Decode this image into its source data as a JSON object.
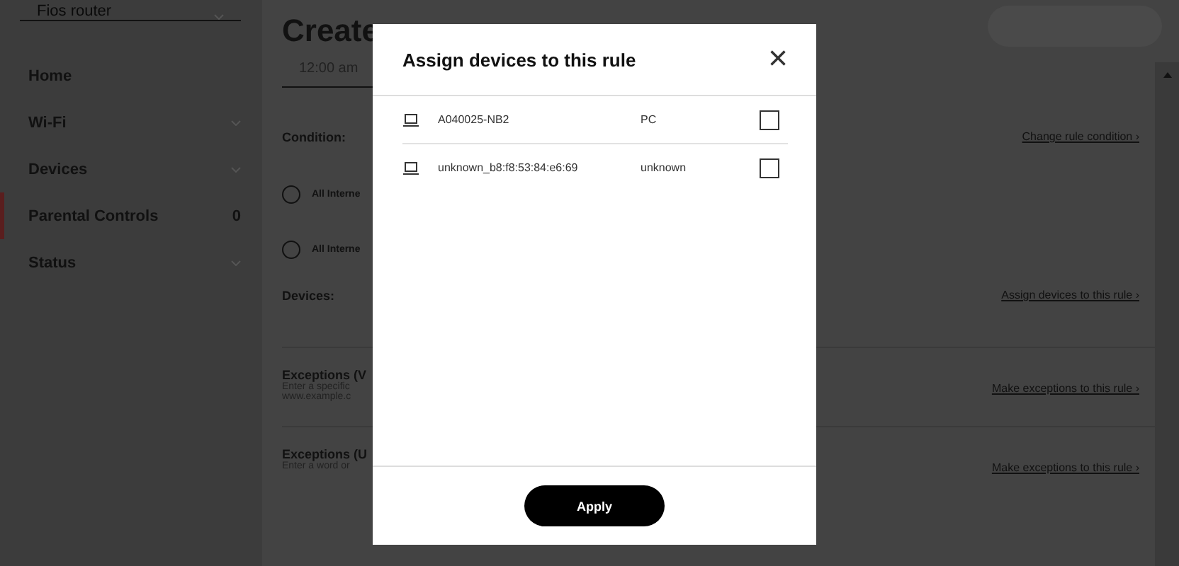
{
  "sidebar": {
    "router_select": "Fios router",
    "items": [
      {
        "label": "Home",
        "kind": "link",
        "selected": false
      },
      {
        "label": "Wi-Fi",
        "kind": "menu",
        "selected": false
      },
      {
        "label": "Devices",
        "kind": "menu",
        "selected": false
      },
      {
        "label": "Parental Controls",
        "kind": "count",
        "count": "0",
        "selected": true
      },
      {
        "label": "Status",
        "kind": "menu",
        "selected": false
      }
    ]
  },
  "main": {
    "title": "Create",
    "time": "12:00 am",
    "sections": [
      {
        "kind": "condition",
        "label": "Condition:",
        "link": "Change rule condition ›",
        "options": [
          {
            "label": "All Interne",
            "selected": false
          },
          {
            "label": "All Interne",
            "selected": false
          }
        ]
      },
      {
        "kind": "plain",
        "label": "Devices:",
        "link": "Assign devices to this rule ›"
      },
      {
        "kind": "note",
        "label": "Exceptions (V",
        "note": [
          "Enter a specific",
          "www.example.c"
        ],
        "link": "Make exceptions to this rule ›"
      },
      {
        "kind": "note",
        "label": "Exceptions (U",
        "note": [
          "Enter a word or"
        ],
        "link": "Make exceptions to this rule ›"
      }
    ]
  },
  "dialog": {
    "title": "Assign devices to this rule",
    "close": "×",
    "devices": [
      {
        "name": "A040025-NB2",
        "type": "PC",
        "checked": false
      },
      {
        "name": "unknown_b8:f8:53:84:e6:69",
        "type": "unknown",
        "checked": false
      }
    ],
    "apply": "Apply"
  }
}
